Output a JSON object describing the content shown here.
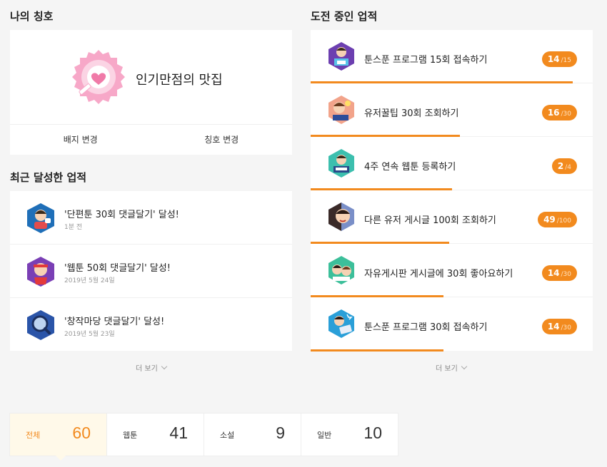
{
  "my_title": {
    "heading": "나의 칭호",
    "title_name": "인기만점의 맛집",
    "badge_icon": "heart-badge-icon",
    "change_badge": "배지 변경",
    "change_title": "칭호 변경"
  },
  "recent": {
    "heading": "최근 달성한 업적",
    "items": [
      {
        "title": "'단편툰 30회 댓글달기' 달성!",
        "time": "1분 전",
        "icon": "comment-character-icon"
      },
      {
        "title": "'웹툰 50회 댓글달기' 달성!",
        "time": "2019년 5월 24일",
        "icon": "headband-character-icon"
      },
      {
        "title": "'창작마당 댓글달기' 달성!",
        "time": "2019년 5월 23일",
        "icon": "magnifier-icon"
      }
    ],
    "more": "더 보기"
  },
  "challenges": {
    "heading": "도전 중인 업적",
    "items": [
      {
        "title": "툰스푼 프로그램 15회 접속하기",
        "current": "14",
        "total": "/15",
        "progress": 0.93,
        "icon": "reading-character-icon"
      },
      {
        "title": "유저꿀팁 30회 조회하기",
        "current": "16",
        "total": "/30",
        "progress": 0.53,
        "icon": "idea-character-icon"
      },
      {
        "title": "4주 연속 웹툰 등록하기",
        "current": "2",
        "total": "/4",
        "progress": 0.5,
        "icon": "study-character-icon"
      },
      {
        "title": "다른 유저 게시글 100회 조회하기",
        "current": "49",
        "total": "/100",
        "progress": 0.49,
        "icon": "face-character-icon"
      },
      {
        "title": "자유게시판 게시글에 30회 좋아요하기",
        "current": "14",
        "total": "/30",
        "progress": 0.47,
        "icon": "thumbs-character-icon"
      },
      {
        "title": "툰스푼 프로그램 30회 접속하기",
        "current": "14",
        "total": "/30",
        "progress": 0.47,
        "icon": "laptop-character-icon"
      }
    ],
    "more": "더 보기"
  },
  "stats": [
    {
      "label": "전체",
      "count": "60",
      "active": true
    },
    {
      "label": "웹툰",
      "count": "41",
      "active": false
    },
    {
      "label": "소설",
      "count": "9",
      "active": false
    },
    {
      "label": "일반",
      "count": "10",
      "active": false
    }
  ],
  "colors": {
    "accent": "#f28a1e",
    "badge_pink": "#f7a8c8",
    "active_bg": "#fff9e9"
  }
}
